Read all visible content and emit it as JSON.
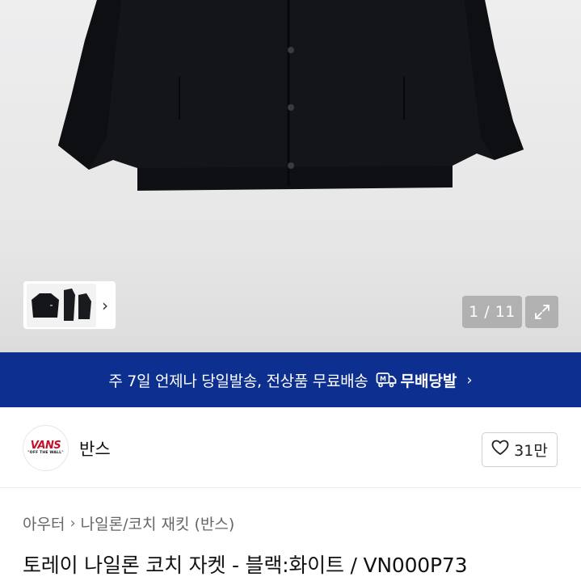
{
  "gallery": {
    "counter": "1 / 11",
    "thumbnail_chevron": "›",
    "icons": {
      "expand": "expand-icon",
      "thumbnail_next": "chevron-right-icon"
    }
  },
  "banner": {
    "text": "주 7일 언제나 당일발송, 전상품 무료배송",
    "brand": "무배당발",
    "chevron": "›",
    "background": "#0d2f8f",
    "icons": {
      "truck": "delivery-truck-icon"
    }
  },
  "brand": {
    "name": "반스",
    "logo_text": "VANS",
    "logo_sub": "\"OFF THE WALL\"",
    "like_count": "31만",
    "logo_color": "#c8102e",
    "icons": {
      "like": "heart-icon"
    }
  },
  "breadcrumb": {
    "items": [
      "아우터",
      "나일론/코치 재킷 (반스)"
    ],
    "separator": "›"
  },
  "product": {
    "title": "토레이 나일론 코치 자켓 - 블랙:화이트 / VN000P73"
  }
}
